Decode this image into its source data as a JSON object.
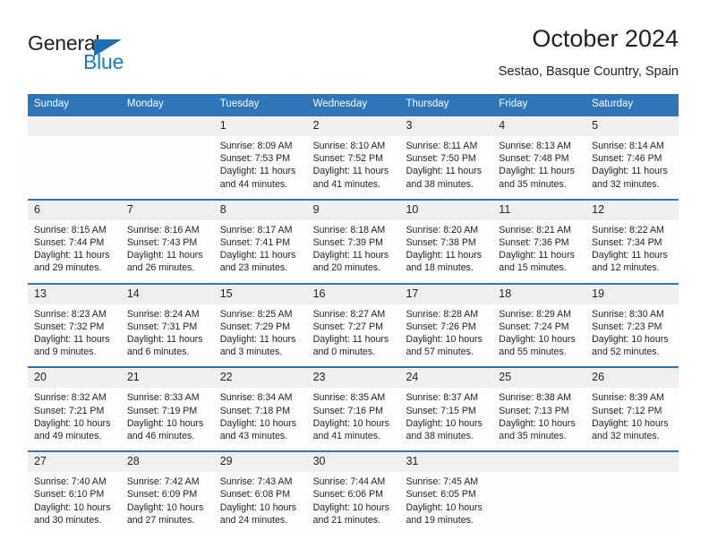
{
  "brand": {
    "name_top": "General",
    "name_bottom": "Blue",
    "accent_color": "#2e76b8",
    "logo_blue": "#1e7ac8",
    "triangle_icon": "triangle-icon"
  },
  "header": {
    "title": "October 2024",
    "subtitle": "Sestao, Basque Country, Spain"
  },
  "calendar": {
    "header_background": "#2e76b8",
    "header_text_color": "#ffffff",
    "date_band_background": "#efefef",
    "cell_background": "#fdfdfd",
    "weekdays": [
      "Sunday",
      "Monday",
      "Tuesday",
      "Wednesday",
      "Thursday",
      "Friday",
      "Saturday"
    ],
    "weeks": [
      [
        {
          "day": "",
          "sunrise": "",
          "sunset": "",
          "daylight_1": "",
          "daylight_2": ""
        },
        {
          "day": "",
          "sunrise": "",
          "sunset": "",
          "daylight_1": "",
          "daylight_2": ""
        },
        {
          "day": "1",
          "sunrise": "Sunrise: 8:09 AM",
          "sunset": "Sunset: 7:53 PM",
          "daylight_1": "Daylight: 11 hours",
          "daylight_2": "and 44 minutes."
        },
        {
          "day": "2",
          "sunrise": "Sunrise: 8:10 AM",
          "sunset": "Sunset: 7:52 PM",
          "daylight_1": "Daylight: 11 hours",
          "daylight_2": "and 41 minutes."
        },
        {
          "day": "3",
          "sunrise": "Sunrise: 8:11 AM",
          "sunset": "Sunset: 7:50 PM",
          "daylight_1": "Daylight: 11 hours",
          "daylight_2": "and 38 minutes."
        },
        {
          "day": "4",
          "sunrise": "Sunrise: 8:13 AM",
          "sunset": "Sunset: 7:48 PM",
          "daylight_1": "Daylight: 11 hours",
          "daylight_2": "and 35 minutes."
        },
        {
          "day": "5",
          "sunrise": "Sunrise: 8:14 AM",
          "sunset": "Sunset: 7:46 PM",
          "daylight_1": "Daylight: 11 hours",
          "daylight_2": "and 32 minutes."
        }
      ],
      [
        {
          "day": "6",
          "sunrise": "Sunrise: 8:15 AM",
          "sunset": "Sunset: 7:44 PM",
          "daylight_1": "Daylight: 11 hours",
          "daylight_2": "and 29 minutes."
        },
        {
          "day": "7",
          "sunrise": "Sunrise: 8:16 AM",
          "sunset": "Sunset: 7:43 PM",
          "daylight_1": "Daylight: 11 hours",
          "daylight_2": "and 26 minutes."
        },
        {
          "day": "8",
          "sunrise": "Sunrise: 8:17 AM",
          "sunset": "Sunset: 7:41 PM",
          "daylight_1": "Daylight: 11 hours",
          "daylight_2": "and 23 minutes."
        },
        {
          "day": "9",
          "sunrise": "Sunrise: 8:18 AM",
          "sunset": "Sunset: 7:39 PM",
          "daylight_1": "Daylight: 11 hours",
          "daylight_2": "and 20 minutes."
        },
        {
          "day": "10",
          "sunrise": "Sunrise: 8:20 AM",
          "sunset": "Sunset: 7:38 PM",
          "daylight_1": "Daylight: 11 hours",
          "daylight_2": "and 18 minutes."
        },
        {
          "day": "11",
          "sunrise": "Sunrise: 8:21 AM",
          "sunset": "Sunset: 7:36 PM",
          "daylight_1": "Daylight: 11 hours",
          "daylight_2": "and 15 minutes."
        },
        {
          "day": "12",
          "sunrise": "Sunrise: 8:22 AM",
          "sunset": "Sunset: 7:34 PM",
          "daylight_1": "Daylight: 11 hours",
          "daylight_2": "and 12 minutes."
        }
      ],
      [
        {
          "day": "13",
          "sunrise": "Sunrise: 8:23 AM",
          "sunset": "Sunset: 7:32 PM",
          "daylight_1": "Daylight: 11 hours",
          "daylight_2": "and 9 minutes."
        },
        {
          "day": "14",
          "sunrise": "Sunrise: 8:24 AM",
          "sunset": "Sunset: 7:31 PM",
          "daylight_1": "Daylight: 11 hours",
          "daylight_2": "and 6 minutes."
        },
        {
          "day": "15",
          "sunrise": "Sunrise: 8:25 AM",
          "sunset": "Sunset: 7:29 PM",
          "daylight_1": "Daylight: 11 hours",
          "daylight_2": "and 3 minutes."
        },
        {
          "day": "16",
          "sunrise": "Sunrise: 8:27 AM",
          "sunset": "Sunset: 7:27 PM",
          "daylight_1": "Daylight: 11 hours",
          "daylight_2": "and 0 minutes."
        },
        {
          "day": "17",
          "sunrise": "Sunrise: 8:28 AM",
          "sunset": "Sunset: 7:26 PM",
          "daylight_1": "Daylight: 10 hours",
          "daylight_2": "and 57 minutes."
        },
        {
          "day": "18",
          "sunrise": "Sunrise: 8:29 AM",
          "sunset": "Sunset: 7:24 PM",
          "daylight_1": "Daylight: 10 hours",
          "daylight_2": "and 55 minutes."
        },
        {
          "day": "19",
          "sunrise": "Sunrise: 8:30 AM",
          "sunset": "Sunset: 7:23 PM",
          "daylight_1": "Daylight: 10 hours",
          "daylight_2": "and 52 minutes."
        }
      ],
      [
        {
          "day": "20",
          "sunrise": "Sunrise: 8:32 AM",
          "sunset": "Sunset: 7:21 PM",
          "daylight_1": "Daylight: 10 hours",
          "daylight_2": "and 49 minutes."
        },
        {
          "day": "21",
          "sunrise": "Sunrise: 8:33 AM",
          "sunset": "Sunset: 7:19 PM",
          "daylight_1": "Daylight: 10 hours",
          "daylight_2": "and 46 minutes."
        },
        {
          "day": "22",
          "sunrise": "Sunrise: 8:34 AM",
          "sunset": "Sunset: 7:18 PM",
          "daylight_1": "Daylight: 10 hours",
          "daylight_2": "and 43 minutes."
        },
        {
          "day": "23",
          "sunrise": "Sunrise: 8:35 AM",
          "sunset": "Sunset: 7:16 PM",
          "daylight_1": "Daylight: 10 hours",
          "daylight_2": "and 41 minutes."
        },
        {
          "day": "24",
          "sunrise": "Sunrise: 8:37 AM",
          "sunset": "Sunset: 7:15 PM",
          "daylight_1": "Daylight: 10 hours",
          "daylight_2": "and 38 minutes."
        },
        {
          "day": "25",
          "sunrise": "Sunrise: 8:38 AM",
          "sunset": "Sunset: 7:13 PM",
          "daylight_1": "Daylight: 10 hours",
          "daylight_2": "and 35 minutes."
        },
        {
          "day": "26",
          "sunrise": "Sunrise: 8:39 AM",
          "sunset": "Sunset: 7:12 PM",
          "daylight_1": "Daylight: 10 hours",
          "daylight_2": "and 32 minutes."
        }
      ],
      [
        {
          "day": "27",
          "sunrise": "Sunrise: 7:40 AM",
          "sunset": "Sunset: 6:10 PM",
          "daylight_1": "Daylight: 10 hours",
          "daylight_2": "and 30 minutes."
        },
        {
          "day": "28",
          "sunrise": "Sunrise: 7:42 AM",
          "sunset": "Sunset: 6:09 PM",
          "daylight_1": "Daylight: 10 hours",
          "daylight_2": "and 27 minutes."
        },
        {
          "day": "29",
          "sunrise": "Sunrise: 7:43 AM",
          "sunset": "Sunset: 6:08 PM",
          "daylight_1": "Daylight: 10 hours",
          "daylight_2": "and 24 minutes."
        },
        {
          "day": "30",
          "sunrise": "Sunrise: 7:44 AM",
          "sunset": "Sunset: 6:06 PM",
          "daylight_1": "Daylight: 10 hours",
          "daylight_2": "and 21 minutes."
        },
        {
          "day": "31",
          "sunrise": "Sunrise: 7:45 AM",
          "sunset": "Sunset: 6:05 PM",
          "daylight_1": "Daylight: 10 hours",
          "daylight_2": "and 19 minutes."
        },
        {
          "day": "",
          "sunrise": "",
          "sunset": "",
          "daylight_1": "",
          "daylight_2": ""
        },
        {
          "day": "",
          "sunrise": "",
          "sunset": "",
          "daylight_1": "",
          "daylight_2": ""
        }
      ]
    ]
  }
}
